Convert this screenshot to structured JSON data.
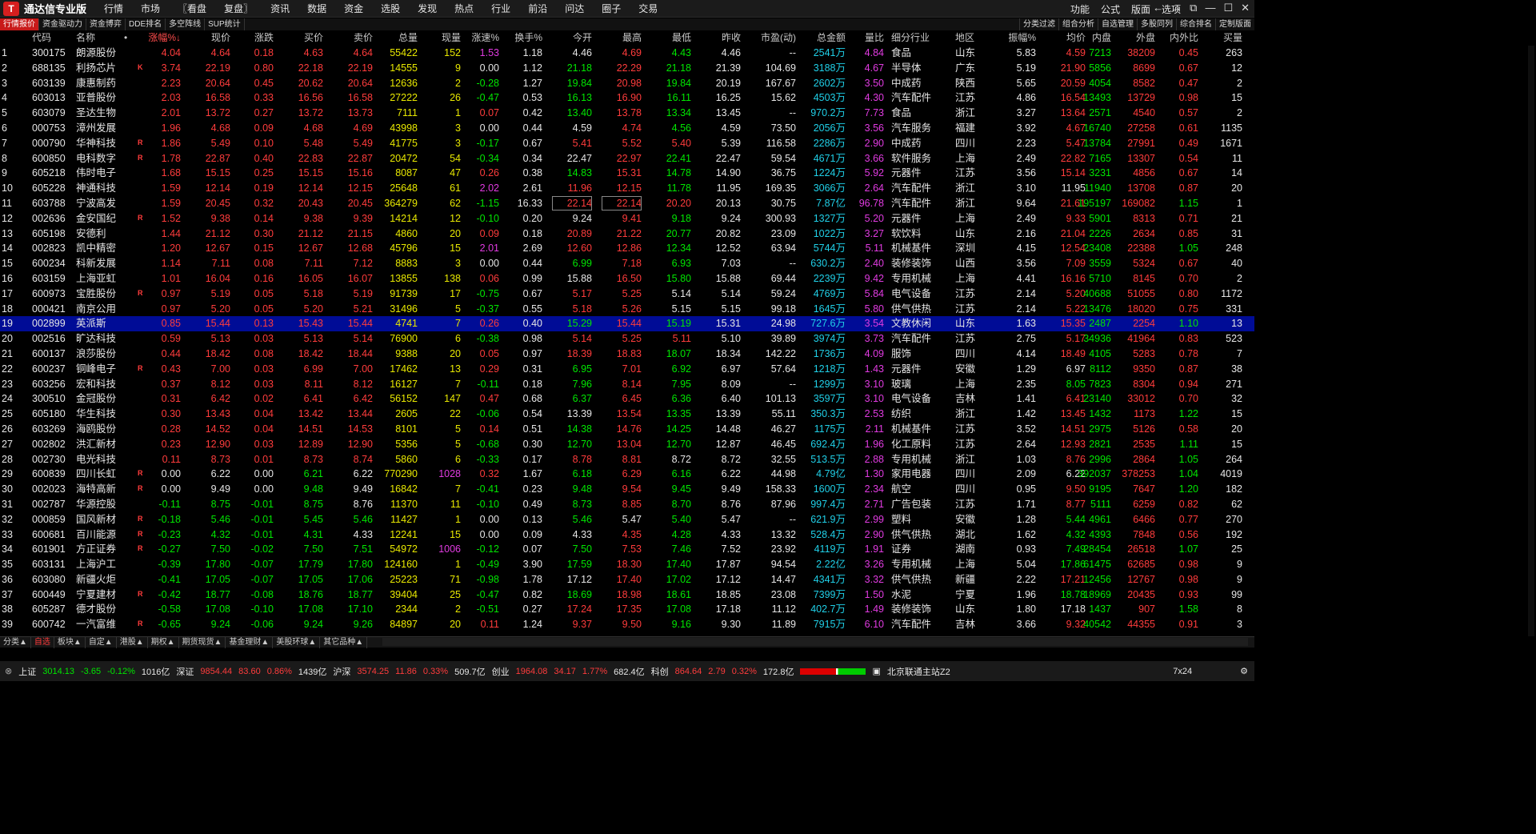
{
  "app": {
    "title": "通达信专业版",
    "menu": [
      "行情",
      "市场",
      "〖看盘",
      "复盘〗",
      "资讯",
      "数据",
      "资金",
      "选股",
      "发现",
      "热点",
      "行业",
      "前沿",
      "问达",
      "圈子",
      "交易"
    ],
    "right_menu": [
      "功能",
      "公式",
      "版面",
      "选项"
    ]
  },
  "toolbar": {
    "left": [
      "行情报价",
      "资金驱动力",
      "资金博弈",
      "DDE排名",
      "多空阵线",
      "SUP统计"
    ],
    "right": [
      "分类过滤",
      "组合分析",
      "自选管理",
      "多股同列",
      "综合排名",
      "定制版面"
    ]
  },
  "columns": [
    "",
    "代码",
    "名称",
    "•",
    "涨幅%↓",
    "现价",
    "涨跌",
    "买价",
    "卖价",
    "总量",
    "现量",
    "涨速%",
    "换手%",
    "今开",
    "最高",
    "最低",
    "昨收",
    "市盈(动)",
    "总金额",
    "量比",
    "细分行业",
    "地区",
    "振幅%",
    "均价",
    "内盘",
    "外盘",
    "内外比",
    "买量"
  ],
  "rows": [
    [
      "1",
      "300175",
      "朗源股份",
      "",
      "4.04",
      "4.64",
      "0.18",
      "4.63",
      "4.64",
      "55422",
      "152",
      "1.53",
      "1.18",
      "4.46",
      "4.69",
      "4.43",
      "4.46",
      "--",
      "2541万",
      "4.84",
      "食品",
      "山东",
      "5.83",
      "4.59",
      "7213",
      "38209",
      "0.45",
      "263"
    ],
    [
      "2",
      "688135",
      "利扬芯片",
      "K",
      "3.74",
      "22.19",
      "0.80",
      "22.18",
      "22.19",
      "14555",
      "9",
      "0.00",
      "1.12",
      "21.18",
      "22.29",
      "21.18",
      "21.39",
      "104.69",
      "3188万",
      "4.67",
      "半导体",
      "广东",
      "5.19",
      "21.90",
      "5856",
      "8699",
      "0.67",
      "12"
    ],
    [
      "3",
      "603139",
      "康惠制药",
      "",
      "2.23",
      "20.64",
      "0.45",
      "20.62",
      "20.64",
      "12636",
      "2",
      "-0.28",
      "1.27",
      "19.84",
      "20.98",
      "19.84",
      "20.19",
      "167.67",
      "2602万",
      "3.50",
      "中成药",
      "陕西",
      "5.65",
      "20.59",
      "4054",
      "8582",
      "0.47",
      "2"
    ],
    [
      "4",
      "603013",
      "亚普股份",
      "",
      "2.03",
      "16.58",
      "0.33",
      "16.56",
      "16.58",
      "27222",
      "26",
      "-0.47",
      "0.53",
      "16.13",
      "16.90",
      "16.11",
      "16.25",
      "15.62",
      "4503万",
      "4.30",
      "汽车配件",
      "江苏",
      "4.86",
      "16.54",
      "13493",
      "13729",
      "0.98",
      "15"
    ],
    [
      "5",
      "603079",
      "圣达生物",
      "",
      "2.01",
      "13.72",
      "0.27",
      "13.72",
      "13.73",
      "7111",
      "1",
      "0.07",
      "0.42",
      "13.40",
      "13.78",
      "13.34",
      "13.45",
      "--",
      "970.2万",
      "7.73",
      "食品",
      "浙江",
      "3.27",
      "13.64",
      "2571",
      "4540",
      "0.57",
      "2"
    ],
    [
      "6",
      "000753",
      "漳州发展",
      "",
      "1.96",
      "4.68",
      "0.09",
      "4.68",
      "4.69",
      "43998",
      "3",
      "0.00",
      "0.44",
      "4.59",
      "4.74",
      "4.56",
      "4.59",
      "73.50",
      "2056万",
      "3.56",
      "汽车服务",
      "福建",
      "3.92",
      "4.67",
      "16740",
      "27258",
      "0.61",
      "1135"
    ],
    [
      "7",
      "000790",
      "华神科技",
      "R",
      "1.86",
      "5.49",
      "0.10",
      "5.48",
      "5.49",
      "41775",
      "3",
      "-0.17",
      "0.67",
      "5.41",
      "5.52",
      "5.40",
      "5.39",
      "116.58",
      "2286万",
      "2.90",
      "中成药",
      "四川",
      "2.23",
      "5.47",
      "13784",
      "27991",
      "0.49",
      "1671"
    ],
    [
      "8",
      "600850",
      "电科数字",
      "R",
      "1.78",
      "22.87",
      "0.40",
      "22.83",
      "22.87",
      "20472",
      "54",
      "-0.34",
      "0.34",
      "22.47",
      "22.97",
      "22.41",
      "22.47",
      "59.54",
      "4671万",
      "3.66",
      "软件服务",
      "上海",
      "2.49",
      "22.82",
      "7165",
      "13307",
      "0.54",
      "11"
    ],
    [
      "9",
      "605218",
      "伟时电子",
      "",
      "1.68",
      "15.15",
      "0.25",
      "15.15",
      "15.16",
      "8087",
      "47",
      "0.26",
      "0.38",
      "14.83",
      "15.31",
      "14.78",
      "14.90",
      "36.75",
      "1224万",
      "5.92",
      "元器件",
      "江苏",
      "3.56",
      "15.14",
      "3231",
      "4856",
      "0.67",
      "14"
    ],
    [
      "10",
      "605228",
      "神通科技",
      "",
      "1.59",
      "12.14",
      "0.19",
      "12.14",
      "12.15",
      "25648",
      "61",
      "2.02",
      "2.61",
      "11.96",
      "12.15",
      "11.78",
      "11.95",
      "169.35",
      "3066万",
      "2.64",
      "汽车配件",
      "浙江",
      "3.10",
      "11.95",
      "11940",
      "13708",
      "0.87",
      "20"
    ],
    [
      "11",
      "603788",
      "宁波高发",
      "",
      "1.59",
      "20.45",
      "0.32",
      "20.43",
      "20.45",
      "364279",
      "62",
      "-1.15",
      "16.33",
      "22.14",
      "22.14",
      "20.20",
      "20.13",
      "30.75",
      "7.87亿",
      "96.78",
      "汽车配件",
      "浙江",
      "9.64",
      "21.61",
      "195197",
      "169082",
      "1.15",
      "1"
    ],
    [
      "12",
      "002636",
      "金安国纪",
      "R",
      "1.52",
      "9.38",
      "0.14",
      "9.38",
      "9.39",
      "14214",
      "12",
      "-0.10",
      "0.20",
      "9.24",
      "9.41",
      "9.18",
      "9.24",
      "300.93",
      "1327万",
      "5.20",
      "元器件",
      "上海",
      "2.49",
      "9.33",
      "5901",
      "8313",
      "0.71",
      "21"
    ],
    [
      "13",
      "605198",
      "安德利",
      "",
      "1.44",
      "21.12",
      "0.30",
      "21.12",
      "21.15",
      "4860",
      "20",
      "0.09",
      "0.18",
      "20.89",
      "21.22",
      "20.77",
      "20.82",
      "23.09",
      "1022万",
      "3.27",
      "软饮料",
      "山东",
      "2.16",
      "21.04",
      "2226",
      "2634",
      "0.85",
      "31"
    ],
    [
      "14",
      "002823",
      "凯中精密",
      "",
      "1.20",
      "12.67",
      "0.15",
      "12.67",
      "12.68",
      "45796",
      "15",
      "2.01",
      "2.69",
      "12.60",
      "12.86",
      "12.34",
      "12.52",
      "63.94",
      "5744万",
      "5.11",
      "机械基件",
      "深圳",
      "4.15",
      "12.54",
      "23408",
      "22388",
      "1.05",
      "248"
    ],
    [
      "15",
      "600234",
      "科新发展",
      "",
      "1.14",
      "7.11",
      "0.08",
      "7.11",
      "7.12",
      "8883",
      "3",
      "0.00",
      "0.44",
      "6.99",
      "7.18",
      "6.93",
      "7.03",
      "--",
      "630.2万",
      "2.40",
      "装修装饰",
      "山西",
      "3.56",
      "7.09",
      "3559",
      "5324",
      "0.67",
      "40"
    ],
    [
      "16",
      "603159",
      "上海亚虹",
      "",
      "1.01",
      "16.04",
      "0.16",
      "16.05",
      "16.07",
      "13855",
      "138",
      "0.06",
      "0.99",
      "15.88",
      "16.50",
      "15.80",
      "15.88",
      "69.44",
      "2239万",
      "9.42",
      "专用机械",
      "上海",
      "4.41",
      "16.16",
      "5710",
      "8145",
      "0.70",
      "2"
    ],
    [
      "17",
      "600973",
      "宝胜股份",
      "R",
      "0.97",
      "5.19",
      "0.05",
      "5.18",
      "5.19",
      "91739",
      "17",
      "-0.75",
      "0.67",
      "5.17",
      "5.25",
      "5.14",
      "5.14",
      "59.24",
      "4769万",
      "5.84",
      "电气设备",
      "江苏",
      "2.14",
      "5.20",
      "40688",
      "51055",
      "0.80",
      "1172"
    ],
    [
      "18",
      "000421",
      "南京公用",
      "",
      "0.97",
      "5.20",
      "0.05",
      "5.20",
      "5.21",
      "31496",
      "5",
      "-0.37",
      "0.55",
      "5.18",
      "5.26",
      "5.15",
      "5.15",
      "99.18",
      "1645万",
      "5.80",
      "供气供热",
      "江苏",
      "2.14",
      "5.22",
      "13476",
      "18020",
      "0.75",
      "331"
    ],
    [
      "19",
      "002899",
      "英派斯",
      "",
      "0.85",
      "15.44",
      "0.13",
      "15.43",
      "15.44",
      "4741",
      "7",
      "0.26",
      "0.40",
      "15.29",
      "15.44",
      "15.19",
      "15.31",
      "24.98",
      "727.6万",
      "3.54",
      "文教休闲",
      "山东",
      "1.63",
      "15.35",
      "2487",
      "2254",
      "1.10",
      "13"
    ],
    [
      "20",
      "002516",
      "旷达科技",
      "",
      "0.59",
      "5.13",
      "0.03",
      "5.13",
      "5.14",
      "76900",
      "6",
      "-0.38",
      "0.98",
      "5.14",
      "5.25",
      "5.11",
      "5.10",
      "39.89",
      "3974万",
      "3.73",
      "汽车配件",
      "江苏",
      "2.75",
      "5.17",
      "34936",
      "41964",
      "0.83",
      "523"
    ],
    [
      "21",
      "600137",
      "浪莎股份",
      "",
      "0.44",
      "18.42",
      "0.08",
      "18.42",
      "18.44",
      "9388",
      "20",
      "0.05",
      "0.97",
      "18.39",
      "18.83",
      "18.07",
      "18.34",
      "142.22",
      "1736万",
      "4.09",
      "服饰",
      "四川",
      "4.14",
      "18.49",
      "4105",
      "5283",
      "0.78",
      "7"
    ],
    [
      "22",
      "600237",
      "铜峰电子",
      "R",
      "0.43",
      "7.00",
      "0.03",
      "6.99",
      "7.00",
      "17462",
      "13",
      "0.29",
      "0.31",
      "6.95",
      "7.01",
      "6.92",
      "6.97",
      "57.64",
      "1218万",
      "1.43",
      "元器件",
      "安徽",
      "1.29",
      "6.97",
      "8112",
      "9350",
      "0.87",
      "38"
    ],
    [
      "23",
      "603256",
      "宏和科技",
      "",
      "0.37",
      "8.12",
      "0.03",
      "8.11",
      "8.12",
      "16127",
      "7",
      "-0.11",
      "0.18",
      "7.96",
      "8.14",
      "7.95",
      "8.09",
      "--",
      "1299万",
      "3.10",
      "玻璃",
      "上海",
      "2.35",
      "8.05",
      "7823",
      "8304",
      "0.94",
      "271"
    ],
    [
      "24",
      "300510",
      "金冠股份",
      "",
      "0.31",
      "6.42",
      "0.02",
      "6.41",
      "6.42",
      "56152",
      "147",
      "0.47",
      "0.68",
      "6.37",
      "6.45",
      "6.36",
      "6.40",
      "101.13",
      "3597万",
      "3.10",
      "电气设备",
      "吉林",
      "1.41",
      "6.41",
      "23140",
      "33012",
      "0.70",
      "32"
    ],
    [
      "25",
      "605180",
      "华生科技",
      "",
      "0.30",
      "13.43",
      "0.04",
      "13.42",
      "13.44",
      "2605",
      "22",
      "-0.06",
      "0.54",
      "13.39",
      "13.54",
      "13.35",
      "13.39",
      "55.11",
      "350.3万",
      "2.53",
      "纺织",
      "浙江",
      "1.42",
      "13.45",
      "1432",
      "1173",
      "1.22",
      "15"
    ],
    [
      "26",
      "603269",
      "海鸥股份",
      "",
      "0.28",
      "14.52",
      "0.04",
      "14.51",
      "14.53",
      "8101",
      "5",
      "0.14",
      "0.51",
      "14.38",
      "14.76",
      "14.25",
      "14.48",
      "46.27",
      "1175万",
      "2.11",
      "机械基件",
      "江苏",
      "3.52",
      "14.51",
      "2975",
      "5126",
      "0.58",
      "20"
    ],
    [
      "27",
      "002802",
      "洪汇新材",
      "",
      "0.23",
      "12.90",
      "0.03",
      "12.89",
      "12.90",
      "5356",
      "5",
      "-0.68",
      "0.30",
      "12.70",
      "13.04",
      "12.70",
      "12.87",
      "46.45",
      "692.4万",
      "1.96",
      "化工原料",
      "江苏",
      "2.64",
      "12.93",
      "2821",
      "2535",
      "1.11",
      "15"
    ],
    [
      "28",
      "002730",
      "电光科技",
      "",
      "0.11",
      "8.73",
      "0.01",
      "8.73",
      "8.74",
      "5860",
      "6",
      "-0.33",
      "0.17",
      "8.78",
      "8.81",
      "8.72",
      "8.72",
      "32.55",
      "513.5万",
      "2.88",
      "专用机械",
      "浙江",
      "1.03",
      "8.76",
      "2996",
      "2864",
      "1.05",
      "264"
    ],
    [
      "29",
      "600839",
      "四川长虹",
      "R",
      "0.00",
      "6.22",
      "0.00",
      "6.21",
      "6.22",
      "770290",
      "1028",
      "0.32",
      "1.67",
      "6.18",
      "6.29",
      "6.16",
      "6.22",
      "44.98",
      "4.79亿",
      "1.30",
      "家用电器",
      "四川",
      "2.09",
      "6.22",
      "392037",
      "378253",
      "1.04",
      "4019"
    ],
    [
      "30",
      "002023",
      "海特高新",
      "R",
      "0.00",
      "9.49",
      "0.00",
      "9.48",
      "9.49",
      "16842",
      "7",
      "-0.41",
      "0.23",
      "9.48",
      "9.54",
      "9.45",
      "9.49",
      "158.33",
      "1600万",
      "2.34",
      "航空",
      "四川",
      "0.95",
      "9.50",
      "9195",
      "7647",
      "1.20",
      "182"
    ],
    [
      "31",
      "002787",
      "华源控股",
      "",
      "-0.11",
      "8.75",
      "-0.01",
      "8.75",
      "8.76",
      "11370",
      "11",
      "-0.10",
      "0.49",
      "8.73",
      "8.85",
      "8.70",
      "8.76",
      "87.96",
      "997.4万",
      "2.71",
      "广告包装",
      "江苏",
      "1.71",
      "8.77",
      "5111",
      "6259",
      "0.82",
      "62"
    ],
    [
      "32",
      "000859",
      "国风新材",
      "R",
      "-0.18",
      "5.46",
      "-0.01",
      "5.45",
      "5.46",
      "11427",
      "1",
      "0.00",
      "0.13",
      "5.46",
      "5.47",
      "5.40",
      "5.47",
      "--",
      "621.9万",
      "2.99",
      "塑料",
      "安徽",
      "1.28",
      "5.44",
      "4961",
      "6466",
      "0.77",
      "270"
    ],
    [
      "33",
      "600681",
      "百川能源",
      "R",
      "-0.23",
      "4.32",
      "-0.01",
      "4.31",
      "4.33",
      "12241",
      "15",
      "0.00",
      "0.09",
      "4.33",
      "4.35",
      "4.28",
      "4.33",
      "13.32",
      "528.4万",
      "2.90",
      "供气供热",
      "湖北",
      "1.62",
      "4.32",
      "4393",
      "7848",
      "0.56",
      "192"
    ],
    [
      "34",
      "601901",
      "方正证券",
      "R",
      "-0.27",
      "7.50",
      "-0.02",
      "7.50",
      "7.51",
      "54972",
      "1006",
      "-0.12",
      "0.07",
      "7.50",
      "7.53",
      "7.46",
      "7.52",
      "23.92",
      "4119万",
      "1.91",
      "证券",
      "湖南",
      "0.93",
      "7.49",
      "28454",
      "26518",
      "1.07",
      "25"
    ],
    [
      "35",
      "603131",
      "上海沪工",
      "",
      "-0.39",
      "17.80",
      "-0.07",
      "17.79",
      "17.80",
      "124160",
      "1",
      "-0.49",
      "3.90",
      "17.59",
      "18.30",
      "17.40",
      "17.87",
      "94.54",
      "2.22亿",
      "3.26",
      "专用机械",
      "上海",
      "5.04",
      "17.86",
      "61475",
      "62685",
      "0.98",
      "9"
    ],
    [
      "36",
      "603080",
      "新疆火炬",
      "",
      "-0.41",
      "17.05",
      "-0.07",
      "17.05",
      "17.06",
      "25223",
      "71",
      "-0.98",
      "1.78",
      "17.12",
      "17.40",
      "17.02",
      "17.12",
      "14.47",
      "4341万",
      "3.32",
      "供气供热",
      "新疆",
      "2.22",
      "17.21",
      "12456",
      "12767",
      "0.98",
      "9"
    ],
    [
      "37",
      "600449",
      "宁夏建材",
      "R",
      "-0.42",
      "18.77",
      "-0.08",
      "18.76",
      "18.77",
      "39404",
      "25",
      "-0.47",
      "0.82",
      "18.69",
      "18.98",
      "18.61",
      "18.85",
      "23.08",
      "7399万",
      "1.50",
      "水泥",
      "宁夏",
      "1.96",
      "18.78",
      "18969",
      "20435",
      "0.93",
      "99"
    ],
    [
      "38",
      "605287",
      "德才股份",
      "",
      "-0.58",
      "17.08",
      "-0.10",
      "17.08",
      "17.10",
      "2344",
      "2",
      "-0.51",
      "0.27",
      "17.24",
      "17.35",
      "17.08",
      "17.18",
      "11.12",
      "402.7万",
      "1.49",
      "装修装饰",
      "山东",
      "1.80",
      "17.18",
      "1437",
      "907",
      "1.58",
      "8"
    ],
    [
      "39",
      "600742",
      "一汽富维",
      "R",
      "-0.65",
      "9.24",
      "-0.06",
      "9.24",
      "9.26",
      "84897",
      "20",
      "0.11",
      "1.24",
      "9.37",
      "9.50",
      "9.16",
      "9.30",
      "11.89",
      "7915万",
      "6.10",
      "汽车配件",
      "吉林",
      "3.66",
      "9.32",
      "40542",
      "44355",
      "0.91",
      "3"
    ]
  ],
  "selected_row": "19",
  "bottom_tabs": [
    "分类▲",
    "自选",
    "板块▲",
    "自定▲",
    "港股▲",
    "期权▲",
    "期货现货▲",
    "基金理财▲",
    "美股环球▲",
    "其它品种▲"
  ],
  "status": {
    "sh_label": "上证",
    "sh": "3014.13",
    "sh_chg": "-3.65",
    "sh_pct": "-0.12%",
    "sh_amt": "1016亿",
    "sz_label": "深证",
    "sz": "9854.44",
    "sz_chg": "83.60",
    "sz_pct": "0.86%",
    "sz_amt": "1439亿",
    "hs_label": "沪深",
    "hs": "3574.25",
    "hs_chg": "11.86",
    "hs_pct": "0.33%",
    "hs_amt": "509.7亿",
    "cy_label": "创业",
    "cy": "1964.08",
    "cy_chg": "34.17",
    "cy_pct": "1.77%",
    "cy_amt": "682.4亿",
    "kc_label": "科创",
    "kc": "864.64",
    "kc_chg": "2.79",
    "kc_pct": "0.32%",
    "kc_amt": "172.8亿",
    "server": "北京联通主站Z2",
    "clock": "7x24"
  }
}
